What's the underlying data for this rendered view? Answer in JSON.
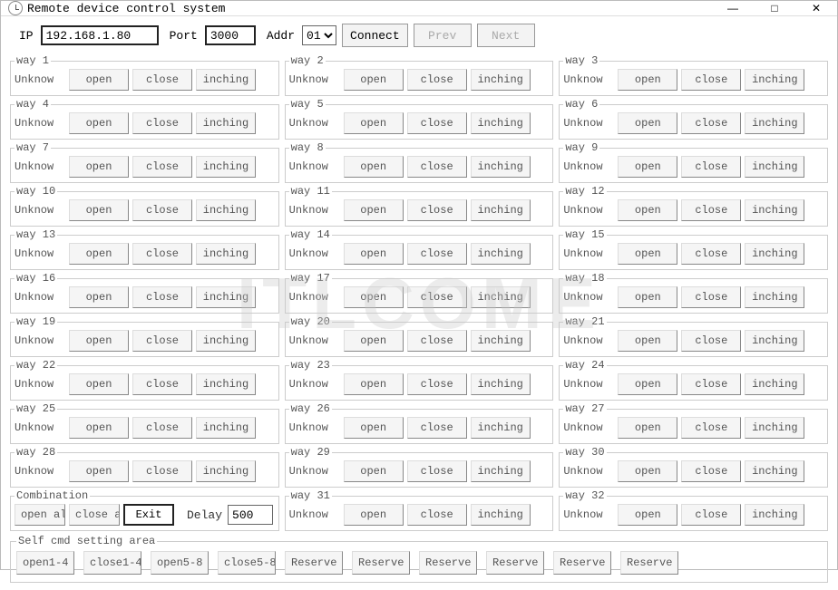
{
  "window": {
    "title": "Remote device control system",
    "min": "—",
    "max": "□",
    "close": "✕"
  },
  "toolbar": {
    "ip_label": "IP",
    "ip_value": "192.168.1.80",
    "port_label": "Port",
    "port_value": "3000",
    "addr_label": "Addr",
    "addr_value": "01",
    "connect": "Connect",
    "prev": "Prev",
    "next": "Next"
  },
  "way_labels": {
    "open": "open",
    "close": "close",
    "inching": "inching",
    "status": "Unknow"
  },
  "ways": [
    {
      "n": 1
    },
    {
      "n": 2
    },
    {
      "n": 3
    },
    {
      "n": 4
    },
    {
      "n": 5
    },
    {
      "n": 6
    },
    {
      "n": 7
    },
    {
      "n": 8
    },
    {
      "n": 9
    },
    {
      "n": 10
    },
    {
      "n": 11
    },
    {
      "n": 12
    },
    {
      "n": 13
    },
    {
      "n": 14
    },
    {
      "n": 15
    },
    {
      "n": 16
    },
    {
      "n": 17
    },
    {
      "n": 18
    },
    {
      "n": 19
    },
    {
      "n": 20
    },
    {
      "n": 21
    },
    {
      "n": 22
    },
    {
      "n": 23
    },
    {
      "n": 24
    },
    {
      "n": 25
    },
    {
      "n": 26
    },
    {
      "n": 27
    },
    {
      "n": 28
    },
    {
      "n": 29
    },
    {
      "n": 30
    },
    {
      "n": 31
    },
    {
      "n": 32
    }
  ],
  "combination": {
    "legend": "Combination",
    "open_all": "open all",
    "close_all": "close all",
    "exit": "Exit",
    "delay_label": "Delay",
    "delay_value": "500"
  },
  "selfcmd": {
    "legend": "Self cmd setting area",
    "buttons": [
      "open1-4",
      "close1-4",
      "open5-8",
      "close5-8",
      "Reserve",
      "Reserve",
      "Reserve",
      "Reserve",
      "Reserve",
      "Reserve"
    ]
  },
  "watermark": "ITLCOME"
}
